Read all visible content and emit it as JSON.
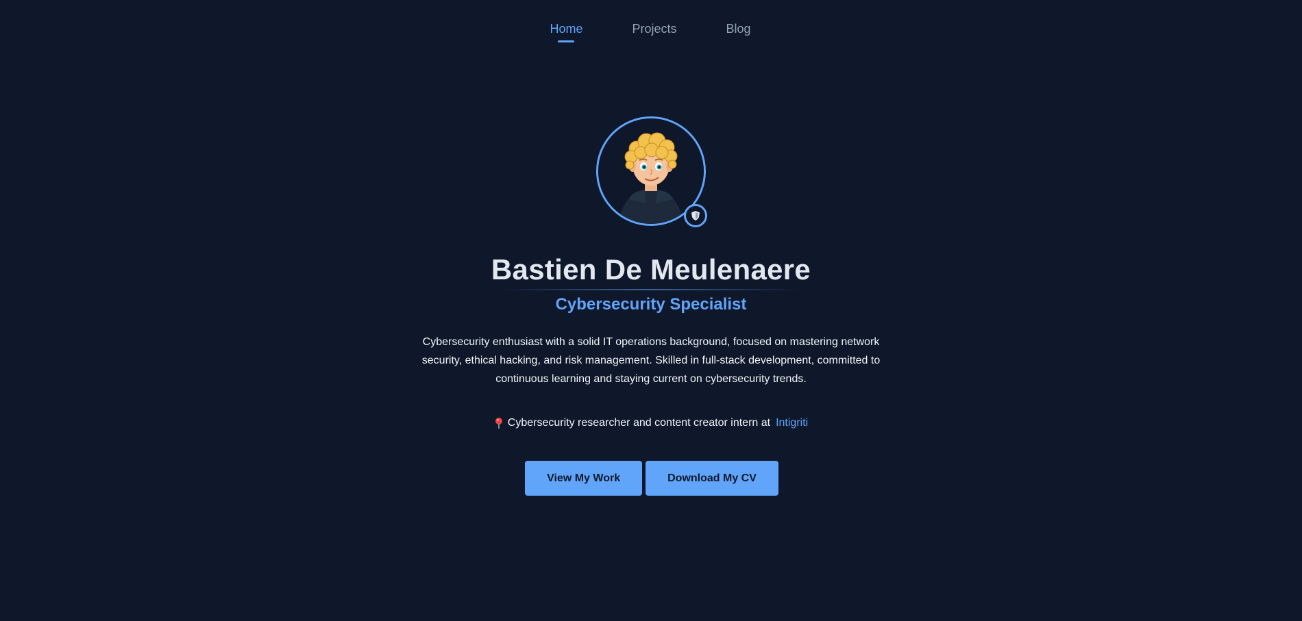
{
  "nav": {
    "items": [
      {
        "label": "Home",
        "active": true
      },
      {
        "label": "Projects",
        "active": false
      },
      {
        "label": "Blog",
        "active": false
      }
    ]
  },
  "hero": {
    "name": "Bastien De Meulenaere",
    "role": "Cybersecurity Specialist",
    "bio": "Cybersecurity enthusiast with a solid IT operations background, focused on mastering network security, ethical hacking, and risk management. Skilled in full-stack development, committed to continuous learning and staying current on cybersecurity trends.",
    "location_icon": "pin-icon",
    "location_text": "Cybersecurity researcher and content creator intern at",
    "location_link": "Intigriti",
    "badge_icon": "shield-icon"
  },
  "buttons": {
    "view_work": "View My Work",
    "download_cv": "Download My CV"
  },
  "colors": {
    "background": "#0f172a",
    "accent": "#60a5fa",
    "text": "#e2e8f0",
    "muted": "#94a3b8"
  }
}
